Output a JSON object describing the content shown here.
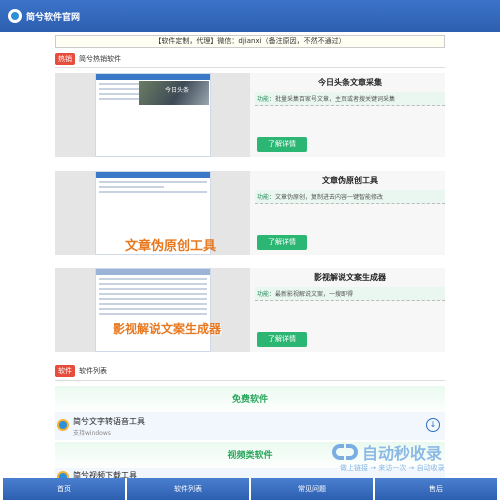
{
  "header": {
    "site_title": "简兮软件官网"
  },
  "notice": "【软件定制，代理】微信：djianxi（备注原因，不然不通过）",
  "hot_section": {
    "tag": "热销",
    "title": "简兮热销软件"
  },
  "products": [
    {
      "title": "今日头条文章采集",
      "feature_label": "功能：",
      "feature": "批量采集百家号文章，主页或者搜关键词采集",
      "button": "了解详情",
      "image_caption": "今日头条"
    },
    {
      "title": "文章伪原创工具",
      "feature_label": "功能：",
      "feature": "文章伪原创，复制进去内容一键智能修改",
      "button": "了解详情",
      "image_caption": "文章伪原创工具"
    },
    {
      "title": "影视解说文案生成器",
      "feature_label": "功能：",
      "feature": "最新影视解说文案，一搜即得",
      "button": "了解详情",
      "image_caption": "影视解说文案生成器"
    }
  ],
  "software_section": {
    "tag": "软件",
    "title": "软件列表"
  },
  "categories": [
    "免费软件",
    "视频类软件"
  ],
  "apps": [
    {
      "name": "简兮文字转语音工具",
      "sub": "支持windows"
    },
    {
      "name": "简兮视频下载工具",
      "sub": ""
    }
  ],
  "watermark": {
    "text": "自动秒收录",
    "sub": "做上链接 → 来访一次 → 自动收录"
  },
  "bottom_nav": [
    "首页",
    "软件列表",
    "常见问题",
    "售后"
  ],
  "icons": {
    "logo": "logo-icon",
    "download": "download-icon"
  },
  "colors": {
    "header": "#2d5fb0",
    "accent_green": "#2bb673",
    "tag_red": "#e74c3c"
  }
}
